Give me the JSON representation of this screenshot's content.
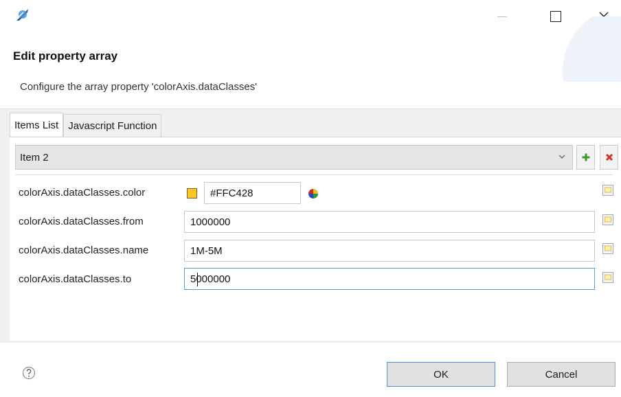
{
  "window": {
    "icon": "eclipse-app-icon",
    "controls": [
      "minimize-icon",
      "maximize-icon",
      "close-icon"
    ]
  },
  "dialog": {
    "title": "Edit property array",
    "description": "Configure the array property 'colorAxis.dataClasses'"
  },
  "tabs": [
    {
      "label": "Items List",
      "active": true
    },
    {
      "label": "Javascript Function",
      "active": false
    }
  ],
  "item_selector": {
    "selected": "Item 2"
  },
  "properties": [
    {
      "label": "colorAxis.dataClasses.color",
      "value": "#FFC428",
      "swatch": "#FFC428"
    },
    {
      "label": "colorAxis.dataClasses.from",
      "value": "1000000"
    },
    {
      "label": "colorAxis.dataClasses.name",
      "value": "1M-5M"
    },
    {
      "label": "colorAxis.dataClasses.to",
      "value": "5000000"
    }
  ],
  "buttons": {
    "ok": "OK",
    "cancel": "Cancel"
  },
  "colors": {
    "accent": "#4a90d9",
    "add": "#3a9a2a",
    "remove": "#d43030"
  }
}
